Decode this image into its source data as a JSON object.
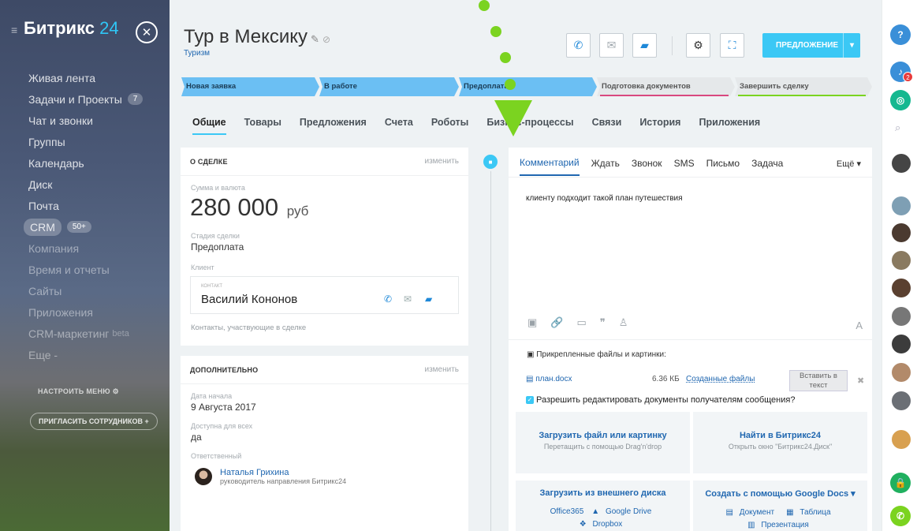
{
  "sidebar": {
    "logo_main": "Битрикс",
    "logo_num": "24",
    "items": [
      {
        "label": "Живая лента",
        "count": ""
      },
      {
        "label": "Задачи и Проекты",
        "count": "7"
      },
      {
        "label": "Чат и звонки",
        "count": ""
      },
      {
        "label": "Группы",
        "count": ""
      },
      {
        "label": "Календарь",
        "count": ""
      },
      {
        "label": "Диск",
        "count": ""
      },
      {
        "label": "Почта",
        "count": ""
      },
      {
        "label": "CRM",
        "count": "50+"
      },
      {
        "label": "Компания",
        "count": ""
      },
      {
        "label": "Время и отчеты",
        "count": ""
      },
      {
        "label": "Сайты",
        "count": ""
      },
      {
        "label": "Приложения",
        "count": ""
      },
      {
        "label": "CRM-маркетинг",
        "count": "",
        "badge": "beta"
      },
      {
        "label": "Еще -",
        "count": ""
      }
    ],
    "setup_label": "НАСТРОИТЬ МЕНЮ",
    "invite_label": "ПРИГЛАСИТЬ СОТРУДНИКОВ"
  },
  "header": {
    "title": "Тур в Мексику",
    "subtitle": "Туризм",
    "proposal_label": "ПРЕДЛОЖЕНИЕ"
  },
  "stages": [
    {
      "label": "Новая заявка"
    },
    {
      "label": "В работе"
    },
    {
      "label": "Предоплата"
    },
    {
      "label": "Подготовка документов"
    },
    {
      "label": "Завершить сделку"
    }
  ],
  "tabs": [
    "Общие",
    "Товары",
    "Предложения",
    "Счета",
    "Роботы",
    "Бизнес-процессы",
    "Связи",
    "История",
    "Приложения"
  ],
  "deal_card": {
    "title": "О СДЕЛКЕ",
    "change": "изменить",
    "sum_label": "Сумма и валюта",
    "sum_value": "280 000",
    "currency": "руб",
    "stage_label": "Стадия сделки",
    "stage_value": "Предоплата",
    "client_label": "Клиент",
    "contact_kind": "КОНТАКТ",
    "contact_name": "Василий Кононов",
    "contacts_note": "Контакты, участвующие в сделке"
  },
  "extra_card": {
    "title": "ДОПОЛНИТЕЛЬНО",
    "change": "изменить",
    "start_label": "Дата начала",
    "start_value": "9 Августа 2017",
    "access_label": "Доступна для всех",
    "access_value": "да",
    "resp_label": "Ответственный",
    "resp_name": "Наталья Грихина",
    "resp_role": "руководитель направления Битрикс24"
  },
  "editor": {
    "tabs": [
      "Комментарий",
      "Ждать",
      "Звонок",
      "SMS",
      "Письмо",
      "Задача"
    ],
    "more": "Ещё",
    "message": "клиенту подходит такой план путешествия",
    "attach_header": "Прикрепленные файлы и картинки:",
    "file_name": "план.docx",
    "file_size": "6.36 КБ",
    "file_folder": "Созданные файлы",
    "insert_label": "Вставить в текст",
    "allow_edit": "Разрешить редактировать документы получателям сообщения?",
    "upload_title": "Загрузить файл или картинку",
    "upload_sub": "Перетащить с помощью Drag'n'drop",
    "find_title": "Найти в Битрикс24",
    "find_sub": "Открыть окно \"Битрикс24.Диск\"",
    "external_title": "Загрузить из внешнего диска",
    "google_title": "Создать с помощью Google Docs",
    "ext_links": [
      "Office365",
      "Google Drive",
      "Dropbox"
    ],
    "google_links": [
      "Документ",
      "Таблица",
      "Презентация"
    ]
  },
  "rail": {
    "help": "?",
    "notif_count": "2"
  },
  "colors": {
    "accent": "#3bc8f5",
    "link": "#2067b0",
    "green_overlay": "#7bd320"
  }
}
